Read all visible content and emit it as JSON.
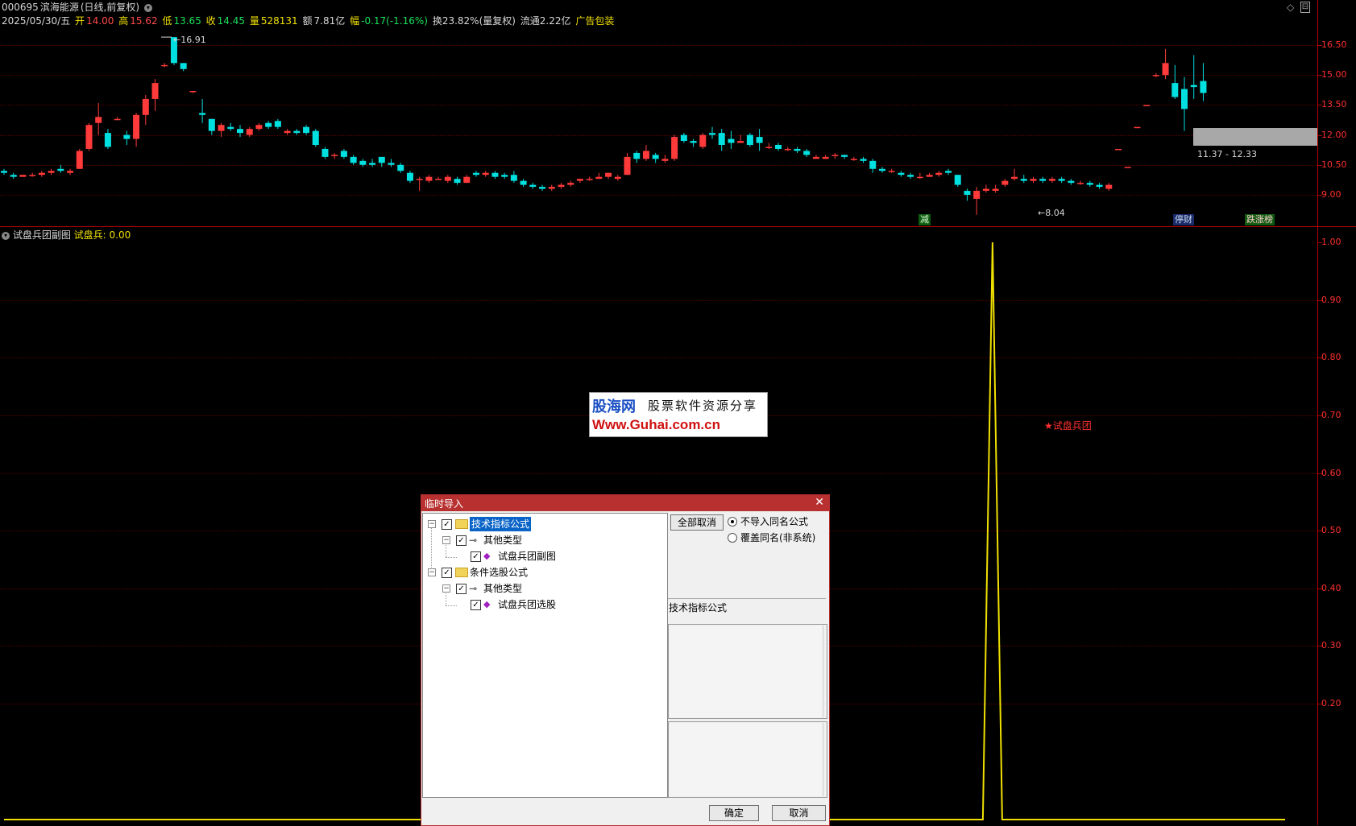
{
  "header": {
    "code": "000695",
    "name": "滨海能源",
    "mode": "(日线,前复权)",
    "date": "2025/05/30/五",
    "open_label": "开",
    "open": "14.00",
    "high_label": "高",
    "high": "15.62",
    "low_label": "低",
    "low": "13.65",
    "close_label": "收",
    "close": "14.45",
    "vol_label": "量",
    "vol": "528131",
    "amt_label": "额",
    "amt": "7.81亿",
    "chg_label": "幅",
    "chg": "-0.17(-1.16%)",
    "turnover": "换23.82%(量复权)",
    "float": "流通2.22亿",
    "ad": "广告包装"
  },
  "main_axis": [
    "16.50",
    "15.00",
    "13.50",
    "12.00",
    "10.50",
    "9.00"
  ],
  "annotations": {
    "high_mark": "16.91",
    "low_mark": "8.04",
    "range_box": "11.37 - 12.33",
    "tag_jian": "减",
    "tag_tingcai": "停财",
    "tag_diezhang": "跌涨榜"
  },
  "sub_panel": {
    "title": "试盘兵团副图",
    "indicator_label": "试盘兵: 0.00",
    "signal_label": "试盘兵团",
    "axis": [
      "1.00",
      "0.90",
      "0.80",
      "0.70",
      "0.60",
      "0.50",
      "0.40",
      "0.30",
      "0.20"
    ]
  },
  "watermark": {
    "brand": "股海网",
    "slogan": "股票软件资源分享",
    "url": "Www.Guhai.com.cn"
  },
  "dialog": {
    "title": "临时导入",
    "tree": {
      "root1": "技术指标公式",
      "root1_child": "其他类型",
      "root1_leaf": "试盘兵团副图",
      "root2": "条件选股公式",
      "root2_child": "其他类型",
      "root2_leaf": "试盘兵团选股"
    },
    "cancel_all": "全部取消",
    "radio1": "不导入同名公式",
    "radio2": "覆盖同名(非系统)",
    "category": "技术指标公式",
    "ok": "确定",
    "cancel": "取消"
  },
  "colors": {
    "up": "#ff3a3a",
    "down": "#00e0e0",
    "axis": "#b00000",
    "indicator": "#f0e000",
    "dialog_title": "#b83030"
  },
  "chart_data": {
    "type": "candlestick",
    "ylim": [
      8.3,
      17.0
    ],
    "candles": [
      [
        10.2,
        10.3,
        10.0,
        10.1
      ],
      [
        10.0,
        10.1,
        9.8,
        9.9
      ],
      [
        9.9,
        10.0,
        9.9,
        10.0
      ],
      [
        10.0,
        10.1,
        9.9,
        10.0
      ],
      [
        10.0,
        10.2,
        9.9,
        10.1
      ],
      [
        10.1,
        10.3,
        10.0,
        10.2
      ],
      [
        10.3,
        10.5,
        10.1,
        10.2
      ],
      [
        10.1,
        10.3,
        10.0,
        10.2
      ],
      [
        10.3,
        11.3,
        10.3,
        11.2
      ],
      [
        11.3,
        12.6,
        11.2,
        12.5
      ],
      [
        12.6,
        13.6,
        12.0,
        12.9
      ],
      [
        12.1,
        12.3,
        11.3,
        11.4
      ],
      [
        12.8,
        12.9,
        12.8,
        12.8
      ],
      [
        12.0,
        12.2,
        11.5,
        11.8
      ],
      [
        11.8,
        13.1,
        11.4,
        13.0
      ],
      [
        13.0,
        14.0,
        12.5,
        13.8
      ],
      [
        13.8,
        14.8,
        13.2,
        14.6
      ],
      [
        15.5,
        15.6,
        15.4,
        15.5
      ],
      [
        16.9,
        16.9,
        15.5,
        15.6
      ],
      [
        15.6,
        15.6,
        15.2,
        15.3
      ],
      [
        14.2,
        14.2,
        14.1,
        14.2
      ],
      [
        13.1,
        13.8,
        12.6,
        13.0
      ],
      [
        12.8,
        12.8,
        12.0,
        12.2
      ],
      [
        12.2,
        12.6,
        11.9,
        12.5
      ],
      [
        12.4,
        12.6,
        12.2,
        12.3
      ],
      [
        12.3,
        12.5,
        11.9,
        12.1
      ],
      [
        12.0,
        12.4,
        11.9,
        12.3
      ],
      [
        12.3,
        12.6,
        12.2,
        12.5
      ],
      [
        12.6,
        12.7,
        12.3,
        12.4
      ],
      [
        12.7,
        12.8,
        12.3,
        12.4
      ],
      [
        12.1,
        12.3,
        12.0,
        12.2
      ],
      [
        12.2,
        12.3,
        12.0,
        12.1
      ],
      [
        12.4,
        12.5,
        12.0,
        12.1
      ],
      [
        12.2,
        12.3,
        11.4,
        11.5
      ],
      [
        11.3,
        11.4,
        10.8,
        10.9
      ],
      [
        11.0,
        11.1,
        10.8,
        11.0
      ],
      [
        11.2,
        11.3,
        10.8,
        10.9
      ],
      [
        10.9,
        11.0,
        10.5,
        10.6
      ],
      [
        10.7,
        10.8,
        10.4,
        10.5
      ],
      [
        10.6,
        10.8,
        10.4,
        10.5
      ],
      [
        10.9,
        10.9,
        10.4,
        10.6
      ],
      [
        10.6,
        10.8,
        10.4,
        10.5
      ],
      [
        10.5,
        10.6,
        10.1,
        10.2
      ],
      [
        10.1,
        10.2,
        9.6,
        9.7
      ],
      [
        9.8,
        9.9,
        9.2,
        9.8
      ],
      [
        9.7,
        10.0,
        9.6,
        9.9
      ],
      [
        9.8,
        9.9,
        9.8,
        9.8
      ],
      [
        9.7,
        10.0,
        9.6,
        9.9
      ],
      [
        9.8,
        9.9,
        9.5,
        9.6
      ],
      [
        9.6,
        10.0,
        9.6,
        9.9
      ],
      [
        10.1,
        10.2,
        9.9,
        10.0
      ],
      [
        10.0,
        10.2,
        9.9,
        10.1
      ],
      [
        10.1,
        10.2,
        9.8,
        9.9
      ],
      [
        10.0,
        10.1,
        9.8,
        9.9
      ],
      [
        10.0,
        10.2,
        9.6,
        9.7
      ],
      [
        9.7,
        9.8,
        9.4,
        9.5
      ],
      [
        9.5,
        9.6,
        9.3,
        9.4
      ],
      [
        9.4,
        9.5,
        9.2,
        9.3
      ],
      [
        9.3,
        9.5,
        9.2,
        9.4
      ],
      [
        9.4,
        9.6,
        9.3,
        9.5
      ],
      [
        9.5,
        9.7,
        9.4,
        9.6
      ],
      [
        9.7,
        9.8,
        9.6,
        9.8
      ],
      [
        9.8,
        9.9,
        9.7,
        9.8
      ],
      [
        9.8,
        10.1,
        9.8,
        9.9
      ],
      [
        9.9,
        10.1,
        9.8,
        10.1
      ],
      [
        9.8,
        10.0,
        9.7,
        9.9
      ],
      [
        10.0,
        11.1,
        10.0,
        10.9
      ],
      [
        11.1,
        11.2,
        10.6,
        10.8
      ],
      [
        10.8,
        11.5,
        10.7,
        11.2
      ],
      [
        11.0,
        11.1,
        10.6,
        10.8
      ],
      [
        10.7,
        11.0,
        10.6,
        10.8
      ],
      [
        10.8,
        12.0,
        10.7,
        11.9
      ],
      [
        12.0,
        12.1,
        11.6,
        11.7
      ],
      [
        11.7,
        11.8,
        11.4,
        11.6
      ],
      [
        11.4,
        12.1,
        11.3,
        12.0
      ],
      [
        12.1,
        12.4,
        11.8,
        12.0
      ],
      [
        12.1,
        12.3,
        11.2,
        11.5
      ],
      [
        11.8,
        12.2,
        11.3,
        11.6
      ],
      [
        11.6,
        12.0,
        11.6,
        11.7
      ],
      [
        12.0,
        12.1,
        11.4,
        11.5
      ],
      [
        11.9,
        12.3,
        11.2,
        11.6
      ],
      [
        11.4,
        11.6,
        11.3,
        11.4
      ],
      [
        11.5,
        11.6,
        11.2,
        11.3
      ],
      [
        11.3,
        11.4,
        11.2,
        11.3
      ],
      [
        11.3,
        11.4,
        11.1,
        11.2
      ],
      [
        11.2,
        11.3,
        10.9,
        11.0
      ],
      [
        10.8,
        11.0,
        10.8,
        10.9
      ],
      [
        10.8,
        11.0,
        10.8,
        10.9
      ],
      [
        11.0,
        11.1,
        10.8,
        11.0
      ],
      [
        11.0,
        11.0,
        10.8,
        10.9
      ],
      [
        10.8,
        10.9,
        10.7,
        10.8
      ],
      [
        10.8,
        10.9,
        10.6,
        10.7
      ],
      [
        10.7,
        10.8,
        10.1,
        10.3
      ],
      [
        10.3,
        10.4,
        10.1,
        10.2
      ],
      [
        10.2,
        10.3,
        10.1,
        10.2
      ],
      [
        10.1,
        10.2,
        9.9,
        10.0
      ],
      [
        10.0,
        10.1,
        9.8,
        9.9
      ],
      [
        9.9,
        10.1,
        9.8,
        9.9
      ],
      [
        9.9,
        10.1,
        9.9,
        10.0
      ],
      [
        10.0,
        10.2,
        9.9,
        10.1
      ],
      [
        10.2,
        10.3,
        10.0,
        10.1
      ],
      [
        10.0,
        10.0,
        9.4,
        9.5
      ],
      [
        9.2,
        9.3,
        8.7,
        9.0
      ],
      [
        8.8,
        9.4,
        8.0,
        9.2
      ],
      [
        9.2,
        9.5,
        9.1,
        9.3
      ],
      [
        9.2,
        9.5,
        9.1,
        9.3
      ],
      [
        9.5,
        9.8,
        9.4,
        9.7
      ],
      [
        9.8,
        10.3,
        9.7,
        9.9
      ],
      [
        9.8,
        10.0,
        9.6,
        9.7
      ],
      [
        9.7,
        9.9,
        9.6,
        9.8
      ],
      [
        9.8,
        9.9,
        9.6,
        9.7
      ],
      [
        9.7,
        9.9,
        9.6,
        9.8
      ],
      [
        9.8,
        9.9,
        9.6,
        9.7
      ],
      [
        9.7,
        9.8,
        9.5,
        9.6
      ],
      [
        9.6,
        9.7,
        9.5,
        9.6
      ],
      [
        9.6,
        9.7,
        9.4,
        9.5
      ],
      [
        9.5,
        9.6,
        9.3,
        9.4
      ],
      [
        9.3,
        9.6,
        9.2,
        9.5
      ],
      [
        11.3,
        11.3,
        11.3,
        11.3
      ],
      [
        10.4,
        10.4,
        10.4,
        10.4
      ],
      [
        12.4,
        12.4,
        12.4,
        12.4
      ],
      [
        13.5,
        13.5,
        13.5,
        13.5
      ],
      [
        15.0,
        15.1,
        14.9,
        15.0
      ],
      [
        15.0,
        16.3,
        14.8,
        15.6
      ],
      [
        14.6,
        15.5,
        13.8,
        13.9
      ],
      [
        14.3,
        14.9,
        12.2,
        13.3
      ],
      [
        14.5,
        16.0,
        13.8,
        14.4
      ],
      [
        14.7,
        15.6,
        13.7,
        14.1
      ]
    ],
    "indicator": {
      "name": "试盘兵",
      "ylim": [
        0,
        1
      ],
      "signal_index": 104,
      "signal_value": 1.0,
      "baseline": 0.0
    }
  }
}
